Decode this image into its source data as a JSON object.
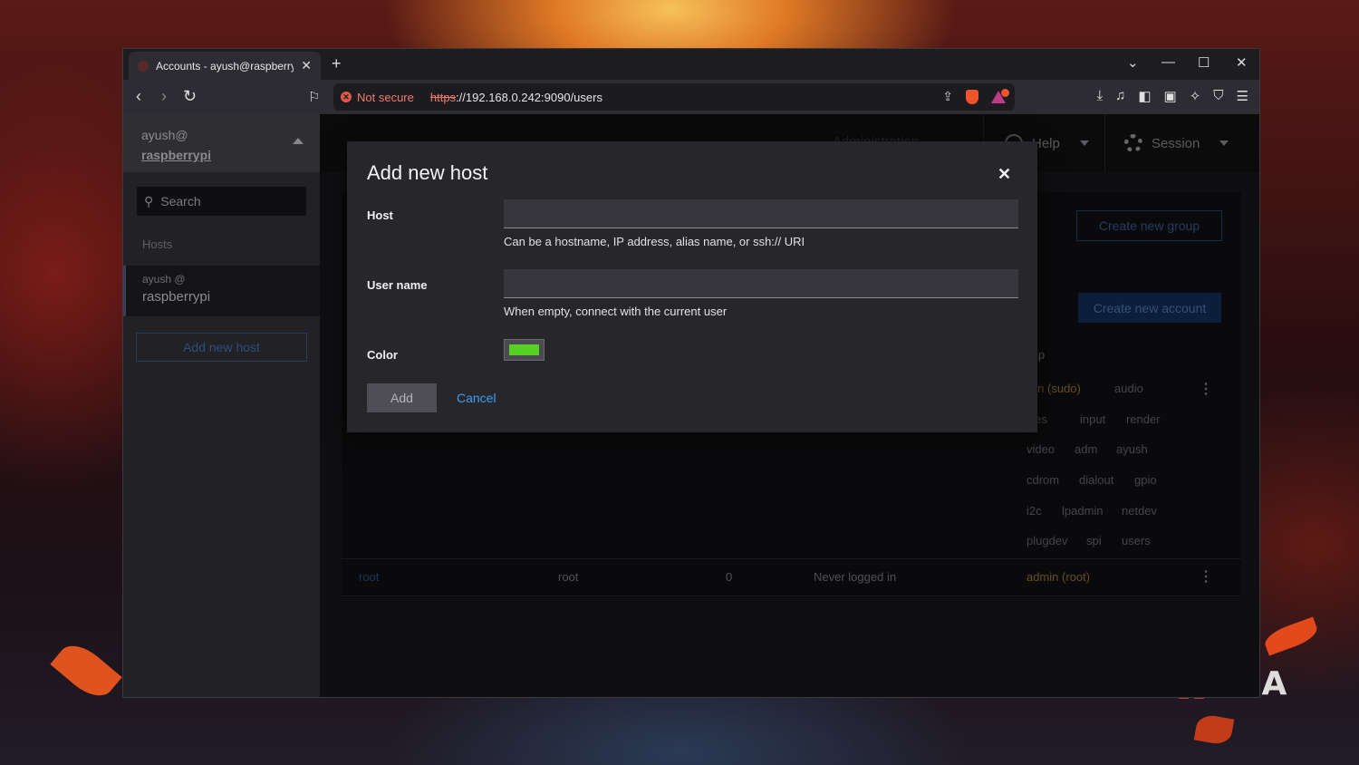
{
  "browser": {
    "tab_title": "Accounts - ayush@raspberrypi",
    "security_label": "Not secure",
    "url_scheme": "https",
    "url_rest": "://192.168.0.242:9090/users"
  },
  "sidebar": {
    "user": "ayush@",
    "host": "raspberrypi",
    "search_placeholder": "Search",
    "section_label": "Hosts",
    "host_item_user": "ayush @",
    "host_item_name": "raspberrypi",
    "add_host_label": "Add new host"
  },
  "masthead": {
    "admin_label": "Administration",
    "help_label": "Help",
    "session_label": "Session"
  },
  "accounts": {
    "create_group_label": "Create new group",
    "create_account_label": "Create new account",
    "group_column": "Group",
    "groups_row1": [
      "admin (sudo)",
      "audio",
      "games",
      "input",
      "render",
      "video",
      "adm",
      "ayush",
      "cdrom",
      "dialout",
      "gpio",
      "i2c",
      "lpadmin",
      "netdev",
      "plugdev",
      "spi",
      "users"
    ],
    "root_row": {
      "username": "root",
      "fullname": "root",
      "id": "0",
      "last_login": "Never logged in",
      "group": "admin (root)"
    }
  },
  "dialog": {
    "title": "Add new host",
    "host_label": "Host",
    "host_value": "",
    "host_help": "Can be a hostname, IP address, alias name, or ssh:// URI",
    "username_label": "User name",
    "username_value": "",
    "username_help": "When empty, connect with the current user",
    "color_label": "Color",
    "color_value": "#56d024",
    "add_label": "Add",
    "cancel_label": "Cancel"
  },
  "watermark": {
    "brand": "XDA"
  },
  "colors": {
    "accent": "#3f9cf0",
    "warning": "#f07a6a"
  }
}
